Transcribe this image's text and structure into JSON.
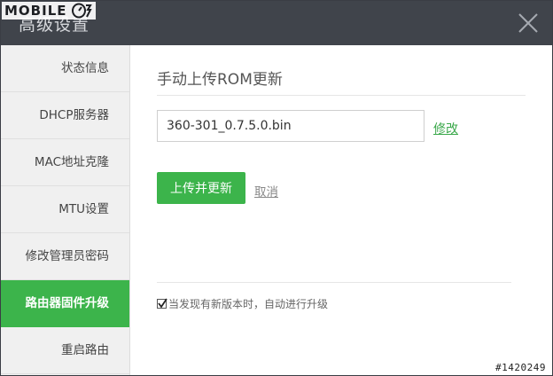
{
  "window": {
    "title": "高级设置"
  },
  "watermark": {
    "logo_text": "MOBILE",
    "id_text": "#1420249"
  },
  "sidebar": {
    "items": [
      {
        "label": "状态信息",
        "active": false
      },
      {
        "label": "DHCP服务器",
        "active": false
      },
      {
        "label": "MAC地址克隆",
        "active": false
      },
      {
        "label": "MTU设置",
        "active": false
      },
      {
        "label": "修改管理员密码",
        "active": false
      },
      {
        "label": "路由器固件升级",
        "active": true
      },
      {
        "label": "重启路由",
        "active": false
      }
    ]
  },
  "main": {
    "section_title": "手动上传ROM更新",
    "file_value": "360-301_0.7.5.0.bin",
    "edit_link": "修改",
    "upload_button": "上传并更新",
    "cancel_link": "取消",
    "auto_update_label": "当发现有新版本时，自动进行升级",
    "auto_update_checked": true
  },
  "colors": {
    "accent": "#3cb44b",
    "titlebar": "#40444b",
    "sidebar_bg": "#f0f0f0"
  },
  "icons": {
    "close": "close-icon",
    "checkbox": "check-icon",
    "logo": "logo-icon"
  }
}
